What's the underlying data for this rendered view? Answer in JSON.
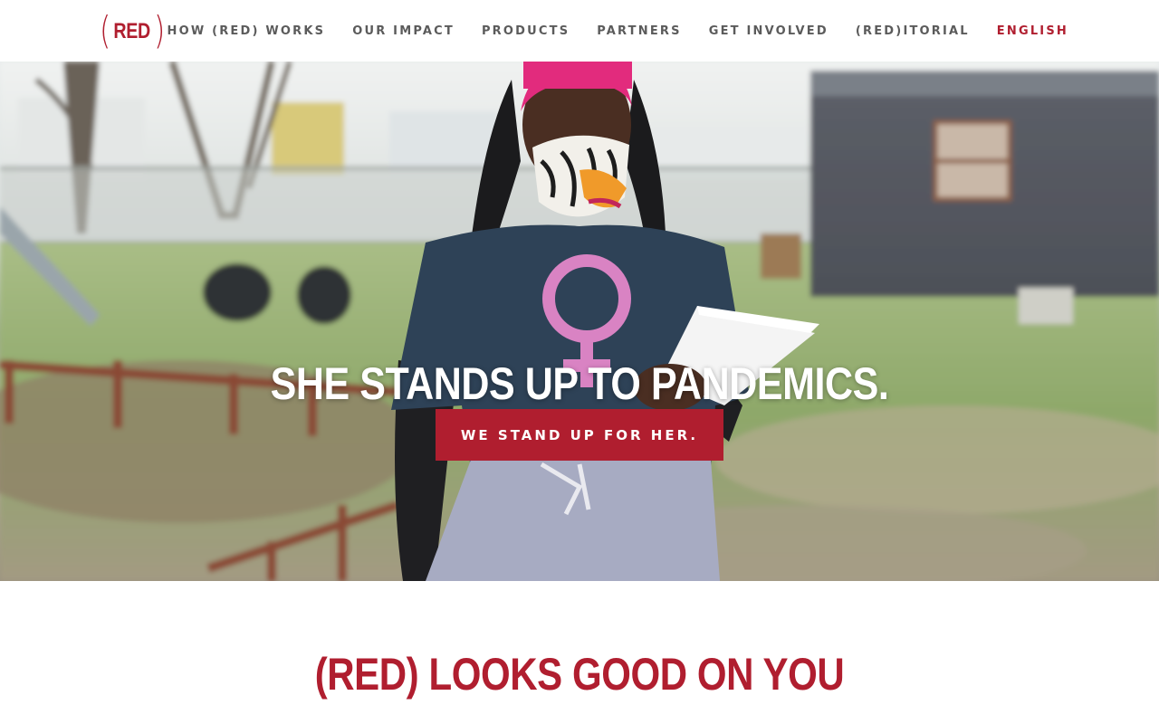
{
  "brand": {
    "name": "RED",
    "accent_color": "#b01e2f"
  },
  "nav": {
    "items": [
      {
        "label": "HOW (RED) WORKS"
      },
      {
        "label": "OUR IMPACT"
      },
      {
        "label": "PRODUCTS"
      },
      {
        "label": "PARTNERS"
      },
      {
        "label": "GET INVOLVED"
      },
      {
        "label": "(RED)ITORIAL"
      }
    ],
    "language": "ENGLISH"
  },
  "hero": {
    "headline": "SHE STANDS UP TO PANDEMICS.",
    "cta_label": "WE STAND UP FOR HER."
  },
  "section": {
    "title": "(RED) LOOKS GOOD ON YOU"
  }
}
